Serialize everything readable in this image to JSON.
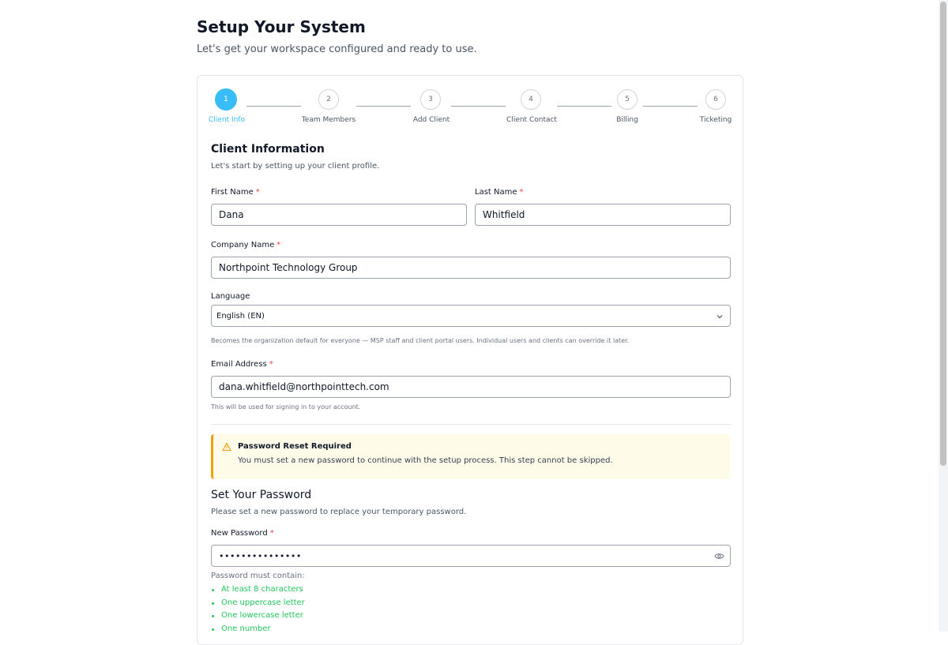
{
  "header": {
    "title": "Setup Your System",
    "subtitle": "Let's get your workspace configured and ready to use."
  },
  "stepper": {
    "active_index": 0,
    "steps": [
      {
        "number": "1",
        "label": "Client Info"
      },
      {
        "number": "2",
        "label": "Team Members"
      },
      {
        "number": "3",
        "label": "Add Client"
      },
      {
        "number": "4",
        "label": "Client Contact"
      },
      {
        "number": "5",
        "label": "Billing"
      },
      {
        "number": "6",
        "label": "Ticketing"
      }
    ]
  },
  "client_info": {
    "title": "Client Information",
    "description": "Let's start by setting up your client profile.",
    "required_marker": "*",
    "first_name": {
      "label": "First Name",
      "value": "Dana"
    },
    "last_name": {
      "label": "Last Name",
      "value": "Whitfield"
    },
    "company_name": {
      "label": "Company Name",
      "value": "Northpoint Technology Group"
    },
    "language": {
      "label": "Language",
      "value": "English (EN)",
      "help": "Becomes the organization default for everyone — MSP staff and client portal users. Individual users and clients can override it later."
    },
    "email": {
      "label": "Email Address",
      "value": "dana.whitfield@northpointtech.com",
      "help": "This will be used for signing in to your account."
    }
  },
  "alert": {
    "title": "Password Reset Required",
    "message": "You must set a new password to continue with the setup process. This step cannot be skipped.",
    "icon": "warning-triangle-icon",
    "color": "#f59e0b",
    "background": "#fefce8"
  },
  "password": {
    "title": "Set Your Password",
    "description": "Please set a new password to replace your temporary password.",
    "new_password": {
      "label": "New Password",
      "value": "•••••••••••••••"
    },
    "requirements_heading": "Password must contain:",
    "requirements": [
      "At least 8 characters",
      "One uppercase letter",
      "One lowercase letter",
      "One number"
    ]
  },
  "colors": {
    "accent": "#38bdf8",
    "success": "#22c55e",
    "required": "#ef4444"
  }
}
